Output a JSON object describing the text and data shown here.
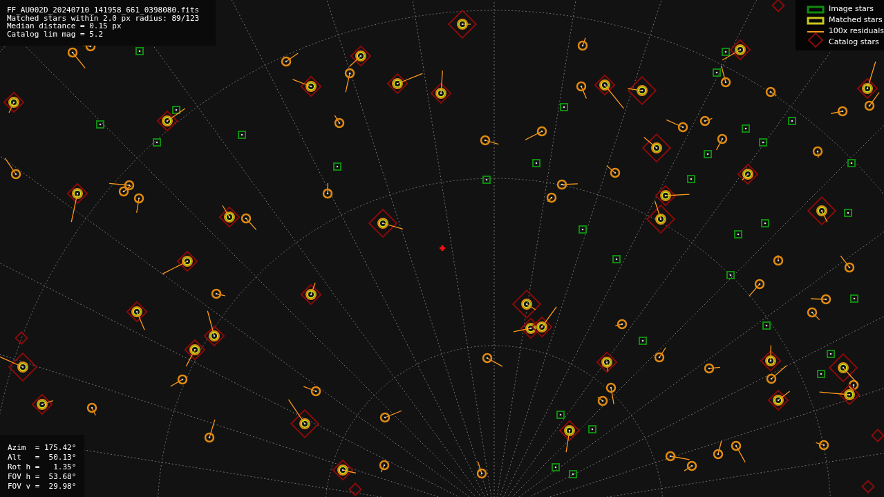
{
  "info": [
    "FF_AU002D_20240710_141958_661_0398080.fits",
    "Matched stars within 2.0 px radius: 89/123",
    "Median distance = 0.15 px",
    "Catalog lim mag = 5.2"
  ],
  "legend": [
    {
      "label": "Image stars",
      "kind": "square",
      "color": "#0f8a0f"
    },
    {
      "label": "Matched stars",
      "kind": "square",
      "color": "#c8c81e"
    },
    {
      "label": "100x residuals",
      "kind": "line",
      "color": "#ff9a1a"
    },
    {
      "label": "Catalog stars",
      "kind": "diamond",
      "color": "#8b0a0a"
    }
  ],
  "pointing": [
    "Azim  = 175.42°",
    "Alt   =  50.13°",
    "Rot h =   1.35°",
    "FOV h =  53.68°",
    "FOV v =  29.98°"
  ]
}
